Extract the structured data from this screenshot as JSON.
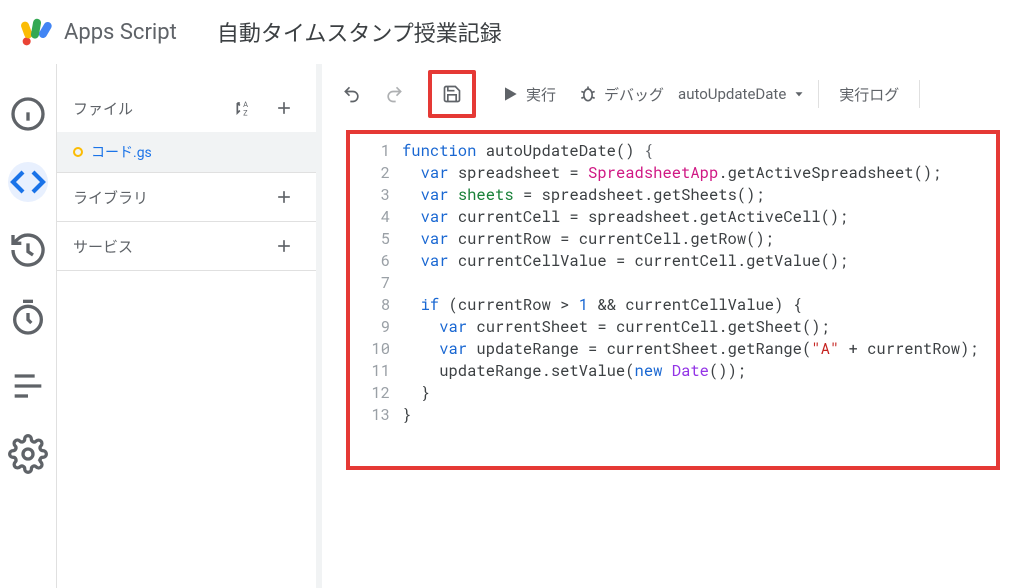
{
  "header": {
    "brand": "Apps Script",
    "title": "自動タイムスタンプ授業記録"
  },
  "sidebar": {
    "files_label": "ファイル",
    "file_name": "コード",
    "file_ext": ".gs",
    "libraries_label": "ライブラリ",
    "services_label": "サービス"
  },
  "toolbar": {
    "run": "実行",
    "debug": "デバッグ",
    "func": "autoUpdateDate",
    "log": "実行ログ"
  },
  "code": {
    "l1_1": "function",
    "l1_2": " autoUpdateDate",
    "l1_3": "() ",
    "l1_4": "{",
    "l2_1": "  ",
    "l2_2": "var",
    "l2_3": " spreadsheet = ",
    "l2_4": "SpreadsheetApp",
    "l2_5": ".getActiveSpreadsheet();",
    "l3_1": "  ",
    "l3_2": "var",
    "l3_3": " ",
    "l3_4": "sheets",
    "l3_5": " = spreadsheet.getSheets();",
    "l4_1": "  ",
    "l4_2": "var",
    "l4_3": " currentCell = spreadsheet.getActiveCell();",
    "l5_1": "  ",
    "l5_2": "var",
    "l5_3": " currentRow = currentCell.getRow();",
    "l6_1": "  ",
    "l6_2": "var",
    "l6_3": " currentCellValue = currentCell.getValue();",
    "l7": "",
    "l8_1": "  ",
    "l8_2": "if",
    "l8_3": " (currentRow > ",
    "l8_4": "1",
    "l8_5": " && currentCellValue) {",
    "l9_1": "    ",
    "l9_2": "var",
    "l9_3": " currentSheet = currentCell.getSheet();",
    "l10_1": "    ",
    "l10_2": "var",
    "l10_3": " updateRange = currentSheet.getRange(",
    "l10_4": "\"A\"",
    "l10_5": " + currentRow);",
    "l11_1": "    updateRange.setValue(",
    "l11_2": "new",
    "l11_3": " ",
    "l11_4": "Date",
    "l11_5": "());",
    "l12": "  }",
    "l13": "}"
  },
  "lines": [
    "1",
    "2",
    "3",
    "4",
    "5",
    "6",
    "7",
    "8",
    "9",
    "10",
    "11",
    "12",
    "13"
  ]
}
